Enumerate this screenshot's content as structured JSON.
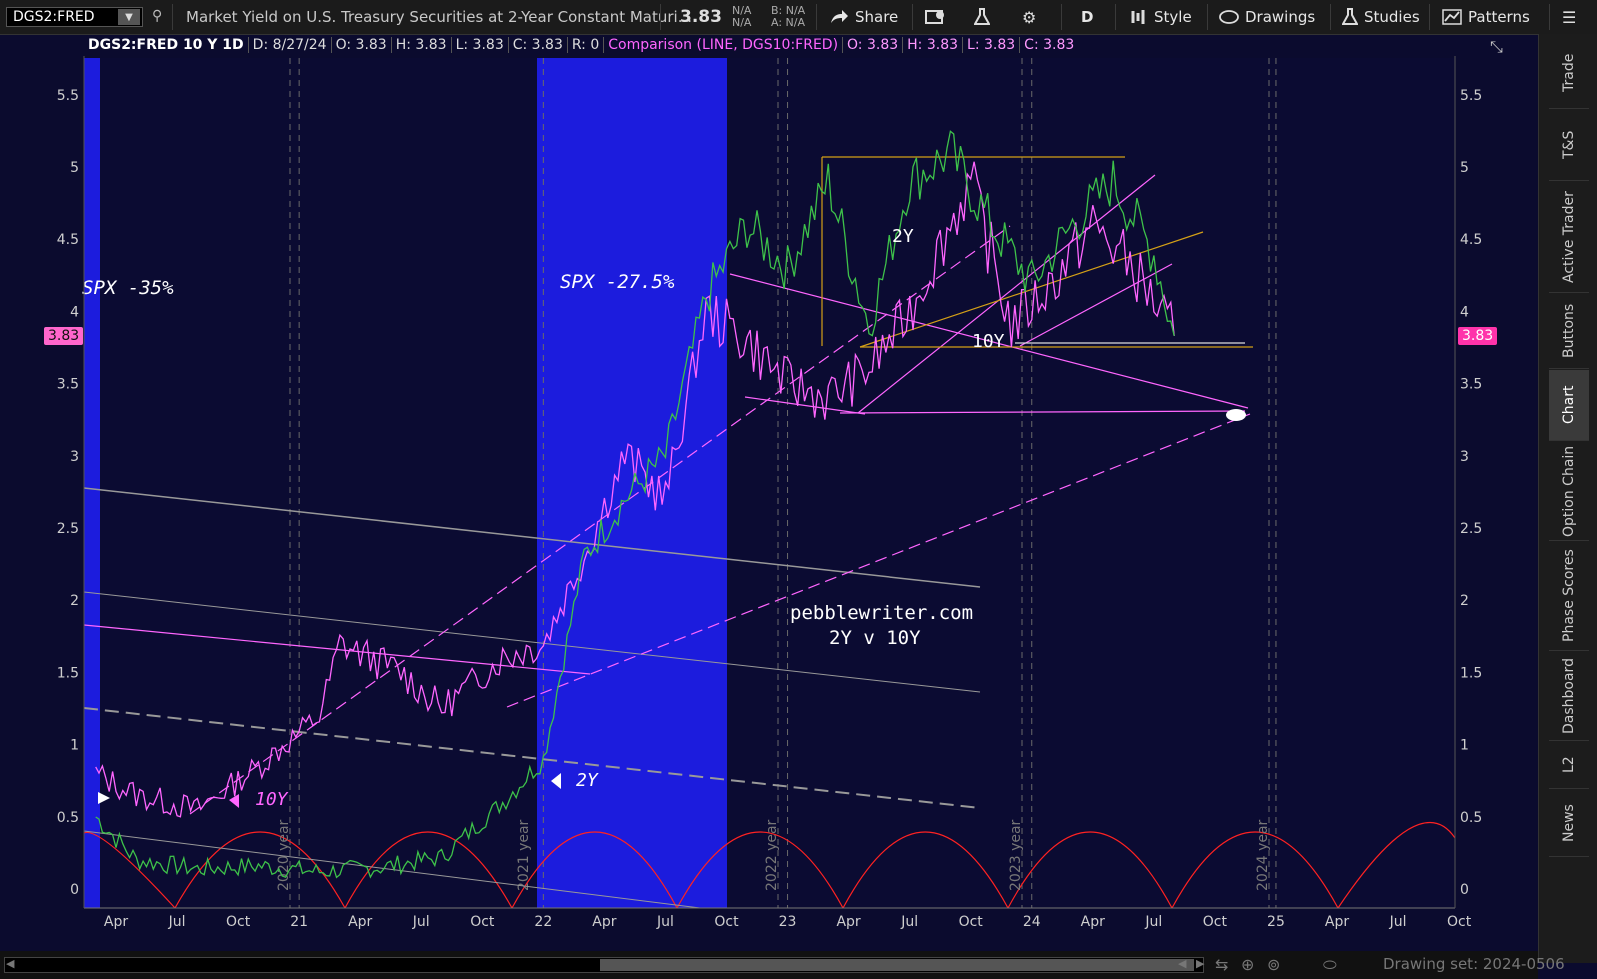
{
  "toolbar": {
    "symbol": "DGS2:FRED",
    "description": "Market Yield on U.S. Treasury Securities at 2-Year Constant Maturi...",
    "last_price": "3.83",
    "bid_ask_1": "N/A",
    "bid_ask_2": "N/A",
    "bid_label": "B: N/A",
    "ask_label": "A: N/A",
    "share_label": "Share",
    "aggregation": "D",
    "style_label": "Style",
    "drawings_label": "Drawings",
    "studies_label": "Studies",
    "patterns_label": "Patterns"
  },
  "chart_header": {
    "title": "DGS2:FRED 10 Y 1D",
    "date": "D: 8/27/24",
    "open": "O: 3.83",
    "high": "H: 3.83",
    "low": "L: 3.83",
    "close": "C: 3.83",
    "range": "R: 0",
    "comparison": "Comparison (LINE, DGS10:FRED)",
    "cmp_open": "O: 3.83",
    "cmp_high": "H: 3.83",
    "cmp_low": "L: 3.83",
    "cmp_close": "C: 3.83"
  },
  "price_pills": {
    "left": "3.83",
    "right": "3.83"
  },
  "sidebar": {
    "tabs": [
      "Trade",
      "T&S",
      "Active Trader",
      "Buttons",
      "Chart",
      "Option Chain",
      "Phase Scores",
      "Dashboard",
      "L2",
      "News"
    ],
    "active": "Chart"
  },
  "bottom": {
    "drawing_set": "Drawing set: 2024-0506"
  },
  "annotations": {
    "spx1": "SPX -35%",
    "spx2": "SPX -27.5%",
    "label_2y_top": "2Y",
    "label_10y_top": "10Y",
    "label_10y_bottom": "10Y",
    "label_2y_bottom": "2Y",
    "site": "pebblewriter.com",
    "subtitle": "2Y v 10Y",
    "year_labels": [
      "2020 year",
      "2021 year",
      "2022 year",
      "2023 year",
      "2024 year"
    ]
  },
  "chart_data": {
    "type": "line",
    "ylim": [
      0,
      5.75
    ],
    "y_ticks": [
      0,
      0.5,
      1,
      1.5,
      2,
      2.5,
      3,
      3.5,
      4,
      4.5,
      5,
      5.5
    ],
    "x_tick_labels": [
      "Apr",
      "Jul",
      "Oct",
      "21",
      "Apr",
      "Jul",
      "Oct",
      "22",
      "Apr",
      "Jul",
      "Oct",
      "23",
      "Apr",
      "Jul",
      "Oct",
      "24",
      "Apr",
      "Jul",
      "Oct",
      "25",
      "Apr",
      "Jul",
      "Oct"
    ],
    "series": [
      {
        "name": "DGS2:FRED",
        "color": "#3ec24a",
        "x": [
          "2020-03",
          "2020-05",
          "2020-08",
          "2020-11",
          "2021-02",
          "2021-05",
          "2021-08",
          "2021-11",
          "2022-01",
          "2022-03",
          "2022-05",
          "2022-07",
          "2022-09",
          "2022-11",
          "2023-01",
          "2023-03",
          "2023-05",
          "2023-07",
          "2023-09",
          "2023-11",
          "2024-01",
          "2024-03",
          "2024-05",
          "2024-07",
          "2024-08"
        ],
        "values": [
          0.5,
          0.2,
          0.14,
          0.16,
          0.12,
          0.15,
          0.22,
          0.6,
          0.9,
          2.3,
          2.7,
          3.0,
          4.1,
          4.6,
          4.3,
          4.9,
          3.9,
          4.9,
          5.1,
          4.6,
          4.2,
          4.6,
          4.9,
          4.4,
          3.83
        ]
      },
      {
        "name": "DGS10:FRED",
        "color": "#ff66ff",
        "x": [
          "2020-03",
          "2020-05",
          "2020-08",
          "2020-11",
          "2021-02",
          "2021-03",
          "2021-06",
          "2021-08",
          "2021-11",
          "2022-01",
          "2022-03",
          "2022-05",
          "2022-07",
          "2022-09",
          "2022-11",
          "2023-01",
          "2023-03",
          "2023-05",
          "2023-07",
          "2023-09",
          "2023-10",
          "2023-12",
          "2024-02",
          "2024-04",
          "2024-06",
          "2024-08"
        ],
        "values": [
          0.8,
          0.65,
          0.55,
          0.85,
          1.2,
          1.7,
          1.5,
          1.25,
          1.6,
          1.7,
          2.3,
          3.0,
          2.7,
          4.0,
          3.8,
          3.5,
          3.4,
          3.6,
          4.0,
          4.6,
          4.9,
          3.9,
          4.2,
          4.6,
          4.3,
          3.83
        ]
      }
    ],
    "shaded_ranges": [
      [
        "2020-01",
        "2020-02"
      ],
      [
        "2022-01",
        "2022-10"
      ]
    ]
  }
}
